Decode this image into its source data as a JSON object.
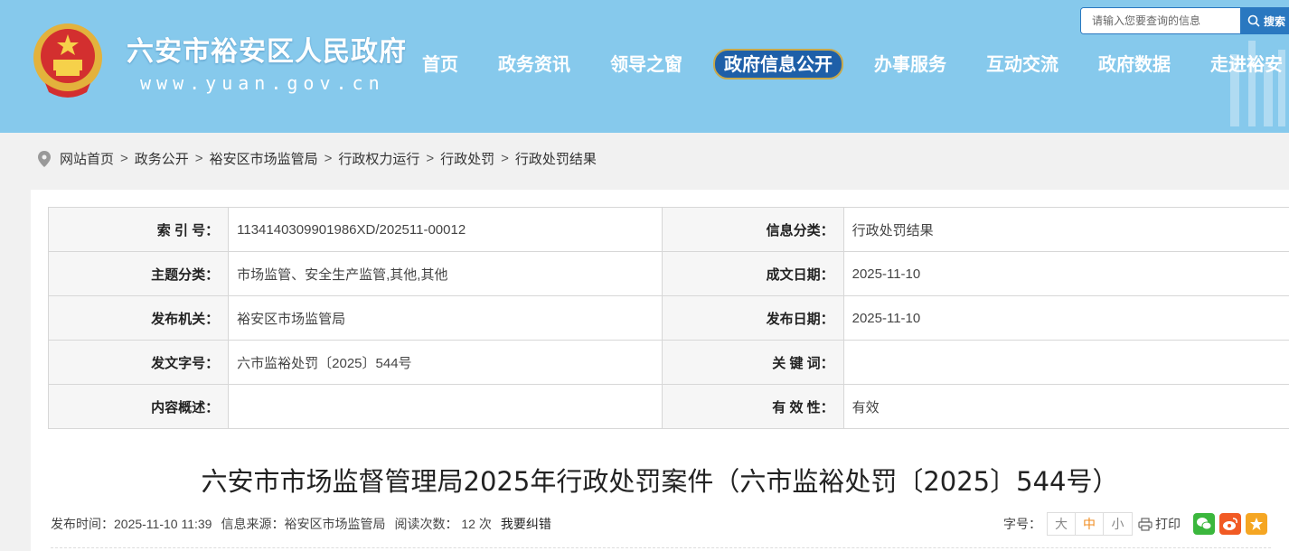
{
  "header": {
    "site_title": "六安市裕安区人民政府",
    "site_domain": "www.yuan.gov.cn",
    "search": {
      "placeholder": "请输入您要查询的信息",
      "button_label": "搜索"
    },
    "nav": [
      "首页",
      "政务资讯",
      "领导之窗",
      "政府信息公开",
      "办事服务",
      "互动交流",
      "政府数据",
      "走进裕安"
    ],
    "active_nav": "政府信息公开"
  },
  "breadcrumb": [
    "网站首页",
    "政务公开",
    "裕安区市场监管局",
    "行政权力运行",
    "行政处罚",
    "行政处罚结果"
  ],
  "meta": {
    "rows": [
      {
        "k1": "索 引 号：",
        "v1": "113414030990198​6XD/202511-00012",
        "k2": "信息分类：",
        "v2": "行政处罚结果"
      },
      {
        "k1": "主题分类：",
        "v1": "市场监管、安全生产监管,其他,其他",
        "k2": "成文日期：",
        "v2": "2025-11-10"
      },
      {
        "k1": "发布机关：",
        "v1": "裕安区市场监管局",
        "k2": "发布日期：",
        "v2": "2025-11-10"
      },
      {
        "k1": "发文字号：",
        "v1": "六市监裕处罚〔2025〕544号",
        "k2": "关 键 词：",
        "v2": ""
      },
      {
        "k1": "内容概述：",
        "v1": "",
        "k2": "有 效 性：",
        "v2": "有效"
      }
    ]
  },
  "article": {
    "title": "六安市市场监督管理局2025年行政处罚案件（六市监裕处罚〔2025〕544号）",
    "publish_time": "发布时间：2025-11-10 11:39",
    "source": "信息来源：裕安区市场监管局",
    "reads": "阅读次数： 12 次",
    "report_link": "我要纠错",
    "font_label": "字号：",
    "font_sizes": [
      "大",
      "中",
      "小"
    ],
    "print_label": "打印"
  },
  "colors": {
    "header_bg": "#86c9ec",
    "nav_active": "#1e5fa8",
    "search_btn": "#2a78c0"
  }
}
